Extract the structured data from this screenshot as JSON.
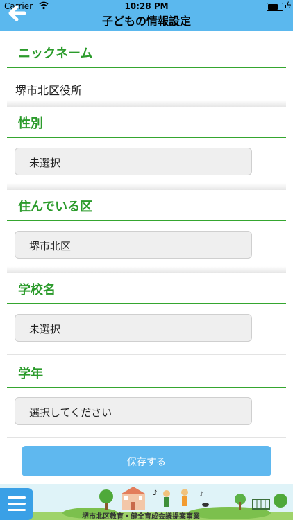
{
  "status_bar": {
    "carrier": "Carrier",
    "time": "10:28 PM"
  },
  "nav": {
    "title": "子どもの情報設定",
    "back_icon": "back-arrow-icon"
  },
  "form": {
    "nickname": {
      "label": "ニックネーム",
      "value": "堺市北区役所"
    },
    "gender": {
      "label": "性別",
      "value": "未選択"
    },
    "ward": {
      "label": "住んでいる区",
      "value": "堺市北区"
    },
    "school": {
      "label": "学校名",
      "value": "未選択"
    },
    "grade": {
      "label": "学年",
      "value": "選択してください"
    }
  },
  "save_button": {
    "label": "保存する"
  },
  "banner": {
    "caption": "堺市北区教育・健全育成会議提案事業"
  },
  "colors": {
    "accent_blue": "#5bb8ee",
    "section_green": "#2b9b2b",
    "save_button": "#5fb8ef",
    "menu_button": "#3aa0e6"
  }
}
